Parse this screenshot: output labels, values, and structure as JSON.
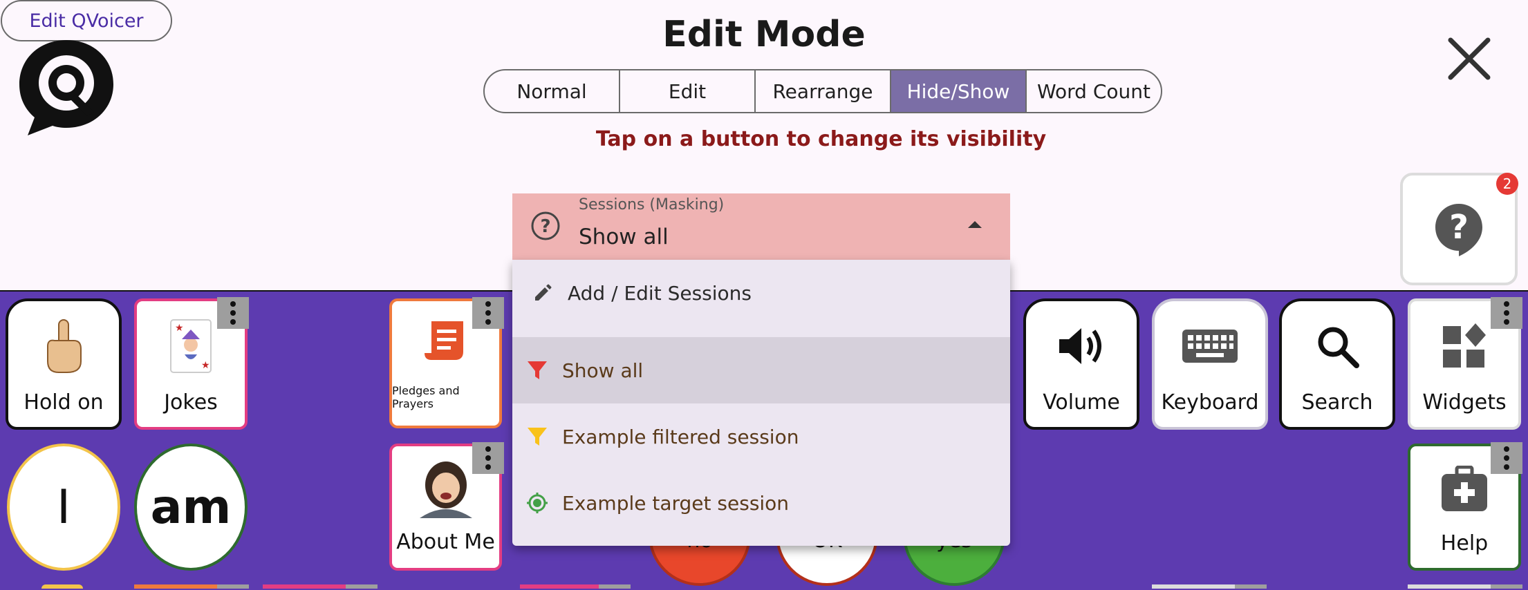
{
  "header": {
    "edit_button": "Edit QVoicer",
    "title": "Edit Mode",
    "hint": "Tap on a button to change its visibility"
  },
  "modes": [
    {
      "label": "Normal",
      "active": false
    },
    {
      "label": "Edit",
      "active": false
    },
    {
      "label": "Rearrange",
      "active": false
    },
    {
      "label": "Hide/Show",
      "active": true
    },
    {
      "label": "Word Count",
      "active": false
    }
  ],
  "sessions": {
    "label": "Sessions (Masking)",
    "value": "Show all",
    "menu": [
      {
        "label": "Add / Edit Sessions",
        "icon": "pencil-icon"
      },
      {
        "label": "Show all",
        "icon": "filter-icon",
        "color": "#e53935",
        "selected": true
      },
      {
        "label": "Example filtered session",
        "icon": "filter-icon",
        "color": "#f9c21a"
      },
      {
        "label": "Example target session",
        "icon": "target-icon",
        "color": "#43a047"
      }
    ]
  },
  "help": {
    "badge": "2"
  },
  "board": {
    "tiles": {
      "hold_on": "Hold on",
      "jokes": "Jokes",
      "pledges": "Pledges and Prayers",
      "about_me": "About Me",
      "volume": "Volume",
      "keyboard": "Keyboard",
      "search": "Search",
      "widgets": "Widgets",
      "help": "Help"
    },
    "words": {
      "i": "I",
      "am": "am"
    },
    "partial": {
      "no": "no",
      "ok": "OK",
      "yes": "yes"
    }
  },
  "colors": {
    "board": "#5d3bb0",
    "active_mode": "#7b6ea6",
    "hint": "#8b1a1a",
    "dropdown": "#efb3b3"
  }
}
